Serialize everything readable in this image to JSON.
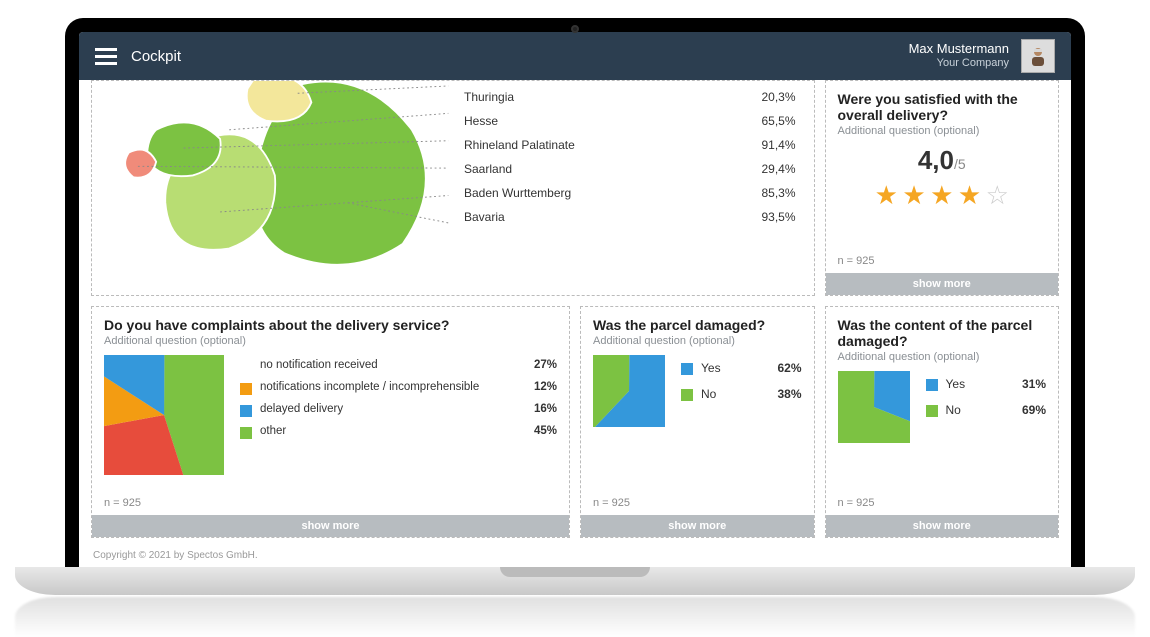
{
  "header": {
    "title": "Cockpit",
    "user_name": "Max Mustermann",
    "company": "Your Company"
  },
  "map_card": {
    "regions": [
      {
        "name": "Thuringia",
        "value": "20,3%"
      },
      {
        "name": "Hesse",
        "value": "65,5%"
      },
      {
        "name": "Rhineland Palatinate",
        "value": "91,4%"
      },
      {
        "name": "Saarland",
        "value": "29,4%"
      },
      {
        "name": "Baden Wurttemberg",
        "value": "85,3%"
      },
      {
        "name": "Bavaria",
        "value": "93,5%"
      }
    ]
  },
  "satisfaction": {
    "title": "Were you satisfied with the overall delivery?",
    "sub": "Additional question (optional)",
    "score": "4,0",
    "of": "/5",
    "stars_full": 4,
    "stars_empty": 1,
    "n": "n = 925",
    "show_more": "show more"
  },
  "complaints": {
    "title": "Do you have complaints about the delivery service?",
    "sub": "Additional question (optional)",
    "n": "n = 925",
    "show_more": "show more",
    "legend": [
      {
        "label": "no notification received",
        "value": "27%",
        "color": "#e74c3c"
      },
      {
        "label": "notifications incomplete / incomprehensible",
        "value": "12%",
        "color": "#f39c12"
      },
      {
        "label": "delayed delivery",
        "value": "16%",
        "color": "#3498db"
      },
      {
        "label": "other",
        "value": "45%",
        "color": "#7cc242"
      }
    ]
  },
  "parcel": {
    "title": "Was the parcel damaged?",
    "sub": "Additional question (optional)",
    "n": "n = 925",
    "show_more": "show more",
    "legend": [
      {
        "label": "Yes",
        "value": "62%",
        "color": "#3498db"
      },
      {
        "label": "No",
        "value": "38%",
        "color": "#7cc242"
      }
    ]
  },
  "content_dmg": {
    "title": "Was the content of the parcel damaged?",
    "sub": "Additional question (optional)",
    "n": "n = 925",
    "show_more": "show more",
    "legend": [
      {
        "label": "Yes",
        "value": "31%",
        "color": "#3498db"
      },
      {
        "label": "No",
        "value": "69%",
        "color": "#7cc242"
      }
    ]
  },
  "footer": "Copyright © 2021 by Spectos GmbH.",
  "colors": {
    "red": "#e74c3c",
    "orange": "#f39c12",
    "blue": "#3498db",
    "green": "#7cc242",
    "lightgreen": "#b8dd73",
    "paleyellow": "#f3e79b",
    "salmon": "#f08b7a"
  },
  "chart_data": [
    {
      "type": "pie",
      "title": "Do you have complaints about the delivery service?",
      "series": [
        {
          "name": "no notification received",
          "value": 27
        },
        {
          "name": "notifications incomplete / incomprehensible",
          "value": 12
        },
        {
          "name": "delayed delivery",
          "value": 16
        },
        {
          "name": "other",
          "value": 45
        }
      ]
    },
    {
      "type": "pie",
      "title": "Was the parcel damaged?",
      "series": [
        {
          "name": "Yes",
          "value": 62
        },
        {
          "name": "No",
          "value": 38
        }
      ]
    },
    {
      "type": "pie",
      "title": "Was the content of the parcel damaged?",
      "series": [
        {
          "name": "Yes",
          "value": 31
        },
        {
          "name": "No",
          "value": 69
        }
      ]
    },
    {
      "type": "table",
      "title": "Region satisfaction map",
      "rows": [
        {
          "region": "Thuringia",
          "percent": 20.3
        },
        {
          "region": "Hesse",
          "percent": 65.5
        },
        {
          "region": "Rhineland Palatinate",
          "percent": 91.4
        },
        {
          "region": "Saarland",
          "percent": 29.4
        },
        {
          "region": "Baden Wurttemberg",
          "percent": 85.3
        },
        {
          "region": "Bavaria",
          "percent": 93.5
        }
      ]
    }
  ]
}
